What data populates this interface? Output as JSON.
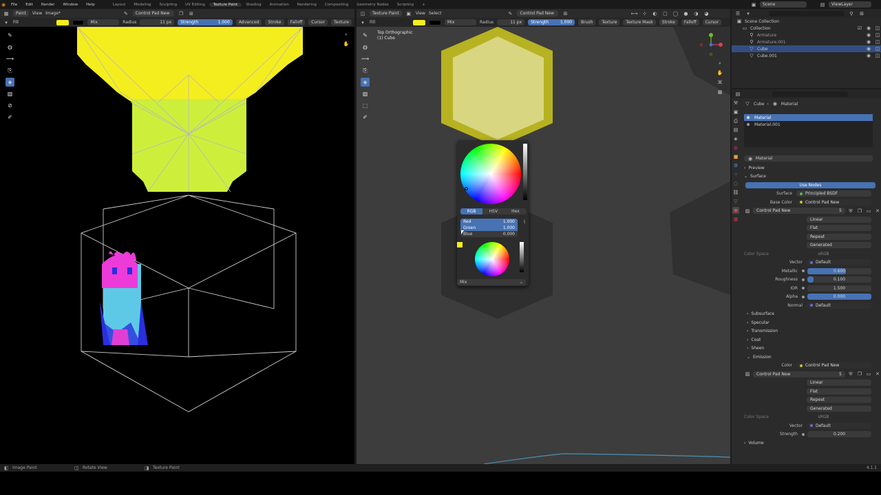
{
  "topmenu": {
    "menus": [
      "File",
      "Edit",
      "Render",
      "Window",
      "Help"
    ],
    "workspaces": [
      "Layout",
      "Modeling",
      "Sculpting",
      "UV Editing",
      "Texture Paint",
      "Shading",
      "Animation",
      "Rendering",
      "Compositing",
      "Geometry Nodes",
      "Scripting"
    ],
    "active_workspace": "Texture Paint",
    "add_tab": "+",
    "scene": "Scene",
    "view_layer": "ViewLayer"
  },
  "left_editor": {
    "header": {
      "mode": "Paint",
      "view": "View",
      "image": "Image*",
      "brush": "Control Pad New"
    },
    "tool_header": {
      "tool": "Fill",
      "blend": "Mix",
      "radius_label": "Radius",
      "radius": "11 px",
      "strength_label": "Strength",
      "strength": "1.000",
      "advanced": "Advanced",
      "stroke": "Stroke",
      "falloff": "Falloff",
      "cursor": "Cursor",
      "texture": "Texture"
    }
  },
  "right_editor": {
    "header": {
      "mode": "Texture Paint",
      "view": "View",
      "select": "Select",
      "brush": "Control Pad New"
    },
    "tool_header": {
      "tool": "Fill",
      "blend": "Mix",
      "radius_label": "Radius",
      "radius": "11 px",
      "strength_label": "Strength",
      "strength": "1.000",
      "brush": "Brush",
      "texture": "Texture",
      "texture_mask": "Texture Mask",
      "stroke": "Stroke",
      "falloff": "Falloff",
      "cursor": "Cursor"
    },
    "overlay_title": "Top Orthographic",
    "overlay_subtitle": "(1) Cube"
  },
  "color_popup": {
    "tabs": [
      "RGB",
      "HSV",
      "Hex"
    ],
    "active_tab": "RGB",
    "red_label": "Red",
    "red_value": "1.000",
    "green_label": "Green",
    "green_value": "1.000",
    "blue_label": "Blue",
    "blue_value": "0.000",
    "blend": "Mix",
    "primary_color": "#f5ee1e"
  },
  "outliner": {
    "items": [
      {
        "label": "Scene Collection",
        "indent": 0
      },
      {
        "label": "Collection",
        "indent": 1
      },
      {
        "label": "Armature",
        "indent": 2
      },
      {
        "label": "Armature.001",
        "indent": 2
      },
      {
        "label": "Cube",
        "indent": 2,
        "selected": true
      },
      {
        "label": "Cube.001",
        "indent": 2
      }
    ]
  },
  "properties": {
    "breadcrumb_object": "Cube",
    "breadcrumb_material": "Material",
    "slots": [
      "Material",
      "Material.001"
    ],
    "material_name": "Material",
    "preview": "Preview",
    "surface": "Surface",
    "use_nodes": "Use Nodes",
    "surface_label": "Surface",
    "surface_value": "Principled BSDF",
    "base_color_label": "Base Color",
    "base_color_value": "Control Pad New",
    "image_name": "Control Pad New",
    "image_users": "5",
    "interp": "Linear",
    "projection": "Flat",
    "extension": "Repeat",
    "source": "Generated",
    "color_space_label": "Color Space",
    "color_space_value": "sRGB",
    "vector_label": "Vector",
    "vector_value": "Default",
    "metallic_label": "Metallic",
    "metallic_value": "0.600",
    "metallic_fill": 0.6,
    "roughness_label": "Roughness",
    "roughness_value": "0.100",
    "roughness_fill": 0.1,
    "ior_label": "IOR",
    "ior_value": "1.500",
    "alpha_label": "Alpha",
    "alpha_value": "0.000",
    "alpha_fill": 1.0,
    "normal_label": "Normal",
    "normal_value": "Default",
    "subpanels": [
      "Subsurface",
      "Specular",
      "Transmission",
      "Coat",
      "Sheen"
    ],
    "emission": "Emission",
    "emission_color_label": "Color",
    "emission_color_value": "Control Pad New",
    "emission_image": "Control Pad New",
    "emission_users": "5",
    "e_interp": "Linear",
    "e_projection": "Flat",
    "e_extension": "Repeat",
    "e_source": "Generated",
    "e_color_space_label": "Color Space",
    "e_color_space_value": "sRGB",
    "e_vector_label": "Vector",
    "e_vector_value": "Default",
    "strength_label": "Strength",
    "strength_value": "0.200",
    "volume": "Volume"
  },
  "statusbar": {
    "left": "Image Paint",
    "middle": "Rotate View",
    "right": "Texture Paint",
    "version": "4.1.1"
  }
}
